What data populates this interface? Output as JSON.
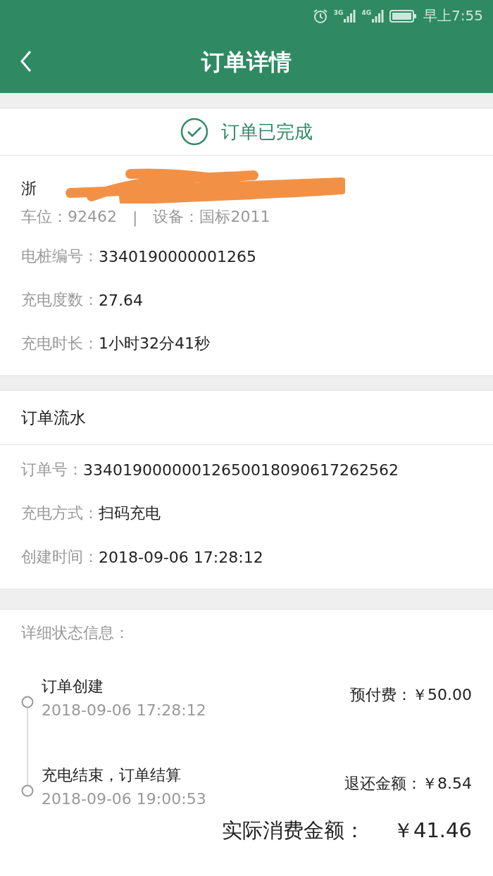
{
  "status_bar": {
    "signals": [
      {
        "label": "3G"
      },
      {
        "label": "4G"
      }
    ],
    "time": "早上7:55"
  },
  "header": {
    "title": "订单详情"
  },
  "order_status": {
    "label": "订单已完成"
  },
  "station": {
    "name": "浙",
    "redacted": true,
    "space_label": "车位：",
    "space": "92462",
    "separator": "|",
    "device_label": "设备：",
    "device": "国标2011",
    "fields": [
      {
        "label": "电桩编号：",
        "value": "3340190000001265"
      },
      {
        "label": "充电度数：",
        "value": "27.64"
      },
      {
        "label": "充电时长：",
        "value": "1小时32分41秒"
      }
    ]
  },
  "flow": {
    "title": "订单流水",
    "fields": [
      {
        "label": "订单号：",
        "value": "33401900000012650018090617262562"
      },
      {
        "label": "充电方式：",
        "value": "扫码充电"
      },
      {
        "label": "创建时间：",
        "value": "2018-09-06 17:28:12"
      }
    ]
  },
  "timeline": {
    "title": "详细状态信息：",
    "events": [
      {
        "name": "订单创建",
        "time": "2018-09-06 17:28:12",
        "amount_label": "预付费：",
        "amount": "￥50.00"
      },
      {
        "name": "充电结束，订单结算",
        "time": "2018-09-06 19:00:53",
        "amount_label": "退还金额：",
        "amount": "￥8.54"
      }
    ],
    "total_label": "实际消费金额：",
    "total": "￥41.46"
  }
}
